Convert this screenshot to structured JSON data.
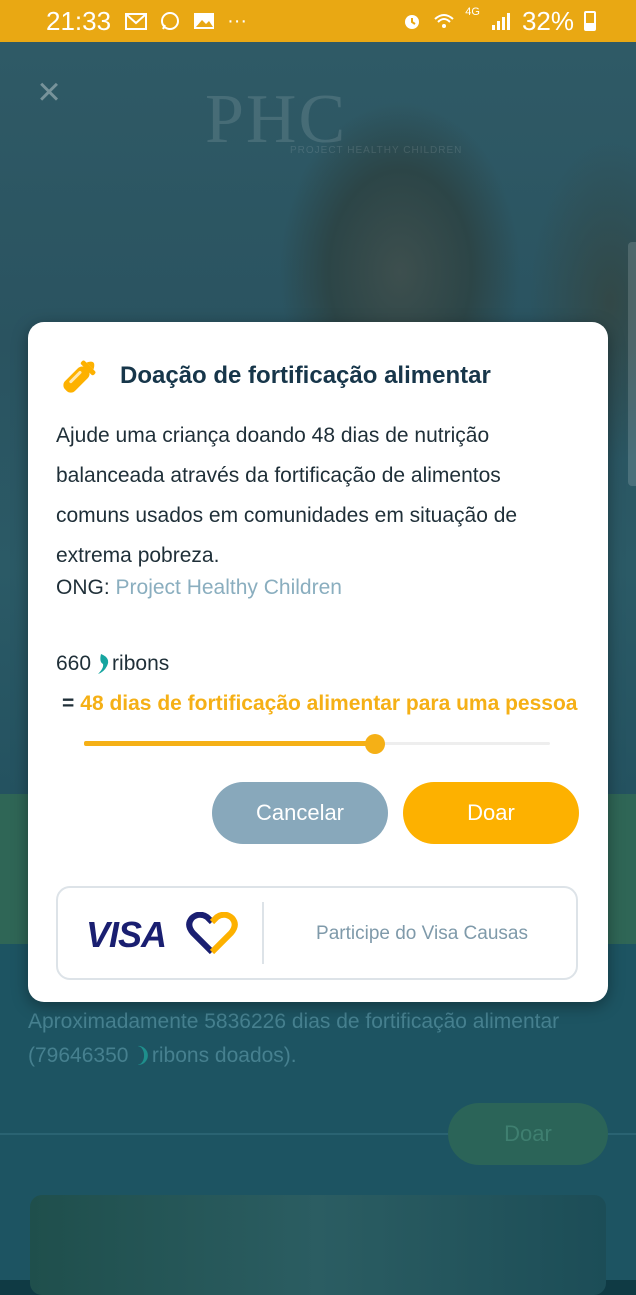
{
  "status_bar": {
    "time": "21:33",
    "network": "4G",
    "battery": "32%",
    "icons_left": [
      "gmail-icon",
      "whatsapp-icon",
      "gallery-icon",
      "more-icon"
    ],
    "icons_right": [
      "alarm-icon",
      "wifi-icon",
      "signal-icon",
      "battery-icon"
    ]
  },
  "background": {
    "logo": "PHC",
    "logo_sub": "PROJECT HEALTHY CHILDREN",
    "stat_text_1": "Aproximadamente 5836226 dias de fortificação alimentar (79646350 ",
    "stat_text_2": "ribons doados).",
    "donate_label": "Doar"
  },
  "modal": {
    "title": "Doação de fortificação alimentar",
    "description": "Ajude uma criança doando 48 dias de nutrição balanceada através da fortificação de alimentos comuns usados em comunidades em situação de extrema pobreza.",
    "ong_label": "ONG:",
    "ong_name": "Project Healthy Children",
    "amount": "660",
    "currency": "ribons",
    "equals": "=",
    "equivalence": "48 dias de fortificação alimentar para uma pessoa",
    "slider_value": 0.625,
    "cancel_label": "Cancelar",
    "donate_label": "Doar",
    "visa_logo": "VISA",
    "visa_cta": "Participe do Visa Causas"
  },
  "colors": {
    "accent": "#fdb100",
    "title": "#17364a",
    "link": "#8aaebf",
    "cancel": "#88a8bb",
    "visa_blue": "#1a1f71"
  }
}
